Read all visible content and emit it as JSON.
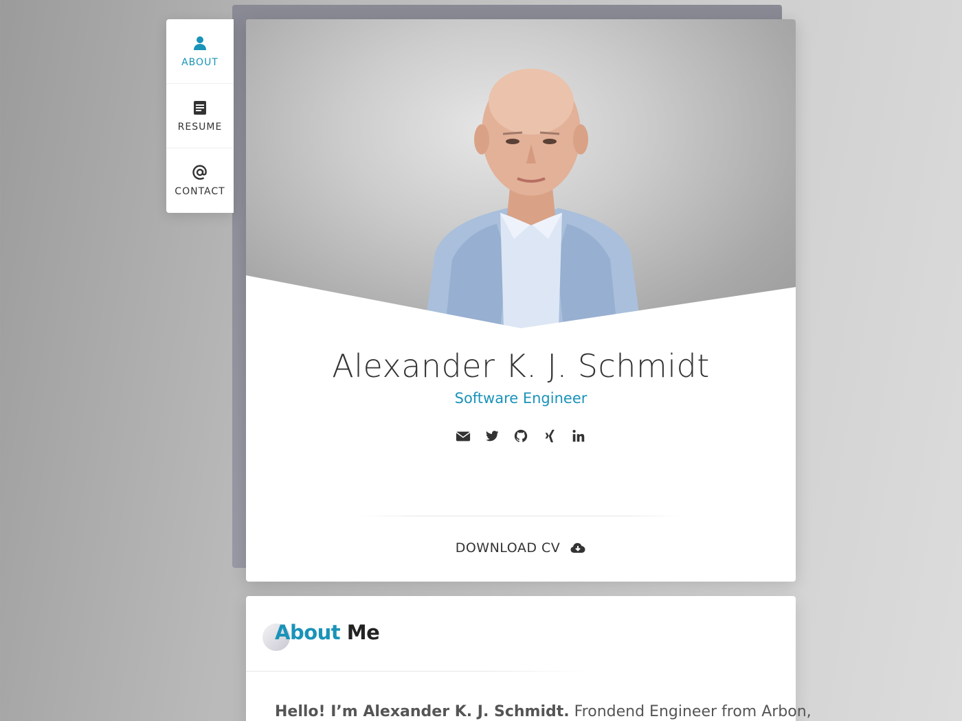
{
  "nav": {
    "items": [
      {
        "label": "ABOUT",
        "icon": "user-icon",
        "active": true
      },
      {
        "label": "RESUME",
        "icon": "document-icon",
        "active": false
      },
      {
        "label": "CONTACT",
        "icon": "at-icon",
        "active": false
      }
    ]
  },
  "profile": {
    "name": "Alexander K. J. Schmidt",
    "role": "Software Engineer",
    "social": [
      "envelope-icon",
      "twitter-icon",
      "github-icon",
      "xing-icon",
      "linkedin-icon"
    ]
  },
  "download": {
    "label": "DOWNLOAD CV",
    "icon": "cloud-download-icon"
  },
  "about": {
    "title_highlight": "About",
    "title_rest": "Me",
    "intro_bold": "Hello! I’m Alexander K. J. Schmidt.",
    "intro_rest": "Frondend Engineer from Arbon,"
  },
  "colors": {
    "accent": "#1a93b8",
    "text": "#333333"
  }
}
